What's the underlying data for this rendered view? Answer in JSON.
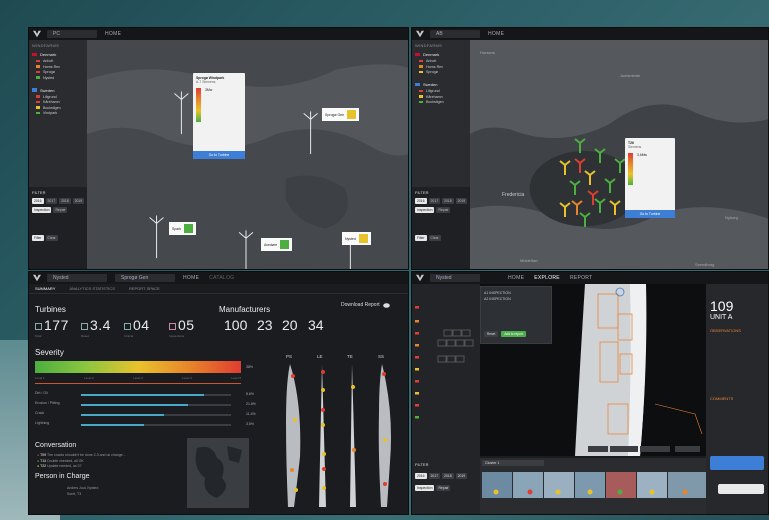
{
  "colors": {
    "accent_blue": "#3d7fd6",
    "sev_green": "#4caf3f",
    "sev_yellow": "#e8c22c",
    "sev_orange": "#e8852a",
    "sev_red": "#e03c31",
    "turbine_white": "#e8e8e8"
  },
  "panel1": {
    "topbar": {
      "select": "PC",
      "item": "HOME"
    },
    "sidebar": {
      "head": "WINDFARMS",
      "countries": [
        {
          "name": "Denmark",
          "color": "#c8102e",
          "farms": [
            {
              "name": "Anholt",
              "count": ""
            },
            {
              "name": "Horns Rev",
              "count": ""
            },
            {
              "name": "Sprogø",
              "count": ""
            },
            {
              "name": "Nysted",
              "count": ""
            }
          ]
        },
        {
          "name": "Sweden",
          "color": "#3d7fd6",
          "farms": [
            {
              "name": "Lillgrund",
              "count": ""
            },
            {
              "name": "Kårehamn",
              "count": ""
            },
            {
              "name": "Bockstigen",
              "count": ""
            },
            {
              "name": "Vindpark",
              "count": ""
            }
          ]
        }
      ]
    },
    "filter": {
      "title": "FILTER",
      "years": [
        "2016",
        "2017",
        "2018",
        "2019"
      ],
      "toggle_a": "Inspection",
      "toggle_b": "Repair",
      "btn_a": "Filter",
      "btn_b": "Clear"
    },
    "popup": {
      "title": "Sprogø Windpark",
      "sub": "A-7 Siemens",
      "value": "3Mw",
      "btn": "Go to Turbine"
    },
    "tags": [
      {
        "label": "Sprogø Gen",
        "color": "#e8c22c"
      },
      {
        "label": "Spark",
        "color": "#4caf3f"
      },
      {
        "label": "Avedøre",
        "color": "#4caf3f"
      },
      {
        "label": "Nysted",
        "color": "#e8c22c"
      }
    ]
  },
  "panel2": {
    "topbar": {
      "select": "AB",
      "item": "HOME"
    },
    "map_labels": [
      "Horsens",
      "Juelsminde",
      "Fredericia",
      "Middelfart",
      "Nyborg",
      "Svendborg"
    ],
    "popup": {
      "title": "T26",
      "sub": "Siemens",
      "value": "3.6Mw",
      "btn": "Go to Turbine"
    }
  },
  "panel3": {
    "topbar": {
      "select": "Nysted",
      "select2": "Sprogø Gen",
      "item": "HOME",
      "item2": "CATALOG"
    },
    "tabs": [
      "SUMMARY",
      "ANALYTICS STATISTICS",
      "REPORT SPACE"
    ],
    "turbines_title": "Turbines",
    "stats": [
      {
        "value": "177",
        "caption": "Total"
      },
      {
        "value": "3.4",
        "caption": "Rated"
      },
      {
        "value": "04",
        "caption": "Critical"
      },
      {
        "value": "05",
        "caption": "Inspections"
      }
    ],
    "mfg_title": "Manufacturers",
    "mfg_values": [
      "100",
      "23",
      "20",
      "34"
    ],
    "download": "Download Report",
    "severity_title": "Severity",
    "severity_levels": [
      "Level 1",
      "Level 2",
      "Level 3",
      "Level 4",
      "Level 5"
    ],
    "severity_pct": "38%",
    "bars": [
      {
        "label": "Dirt / Oil",
        "pct": "8.6%",
        "frac": 0.82
      },
      {
        "label": "Erosion / Pitting",
        "pct": "21.6%",
        "frac": 0.71
      },
      {
        "label": "Crack",
        "pct": "11.4%",
        "frac": 0.55
      },
      {
        "label": "Lightning",
        "pct": "3.5%",
        "frac": 0.42
      }
    ],
    "conversation_title": "Conversation",
    "messages": [
      {
        "id": "T09",
        "text": "The cracks shouldn't be done 2-3 and ok change..."
      },
      {
        "id": "T13",
        "text": "Double checked, all OK"
      },
      {
        "id": "T22",
        "text": "Update needed, as 07"
      }
    ],
    "person_title": "Person in Charge",
    "persons": [
      "Anders Juul, Nysted",
      "Sorel, T3"
    ],
    "blade_labels": [
      "PS",
      "LE",
      "TE",
      "SS"
    ]
  },
  "panel4": {
    "topbar": {
      "select": "Nysted",
      "items": [
        "HOME",
        "EXPLORE",
        "REPORT"
      ]
    },
    "dropdown": {
      "items": [
        "A1 INSPECTION",
        "A2 INSPECTION"
      ],
      "btn_a": "Reset",
      "btn_b": "Add to report"
    },
    "strip_select": "Cluster 1",
    "big_id": "109",
    "unit": "UNIT A",
    "subtitle": "OBSERVATIONS",
    "comments": "COMMENTS",
    "filter": "FILTER",
    "years": [
      "2016",
      "2017",
      "2018",
      "2019"
    ],
    "toggle_a": "Inspection",
    "toggle_b": "Repair"
  }
}
